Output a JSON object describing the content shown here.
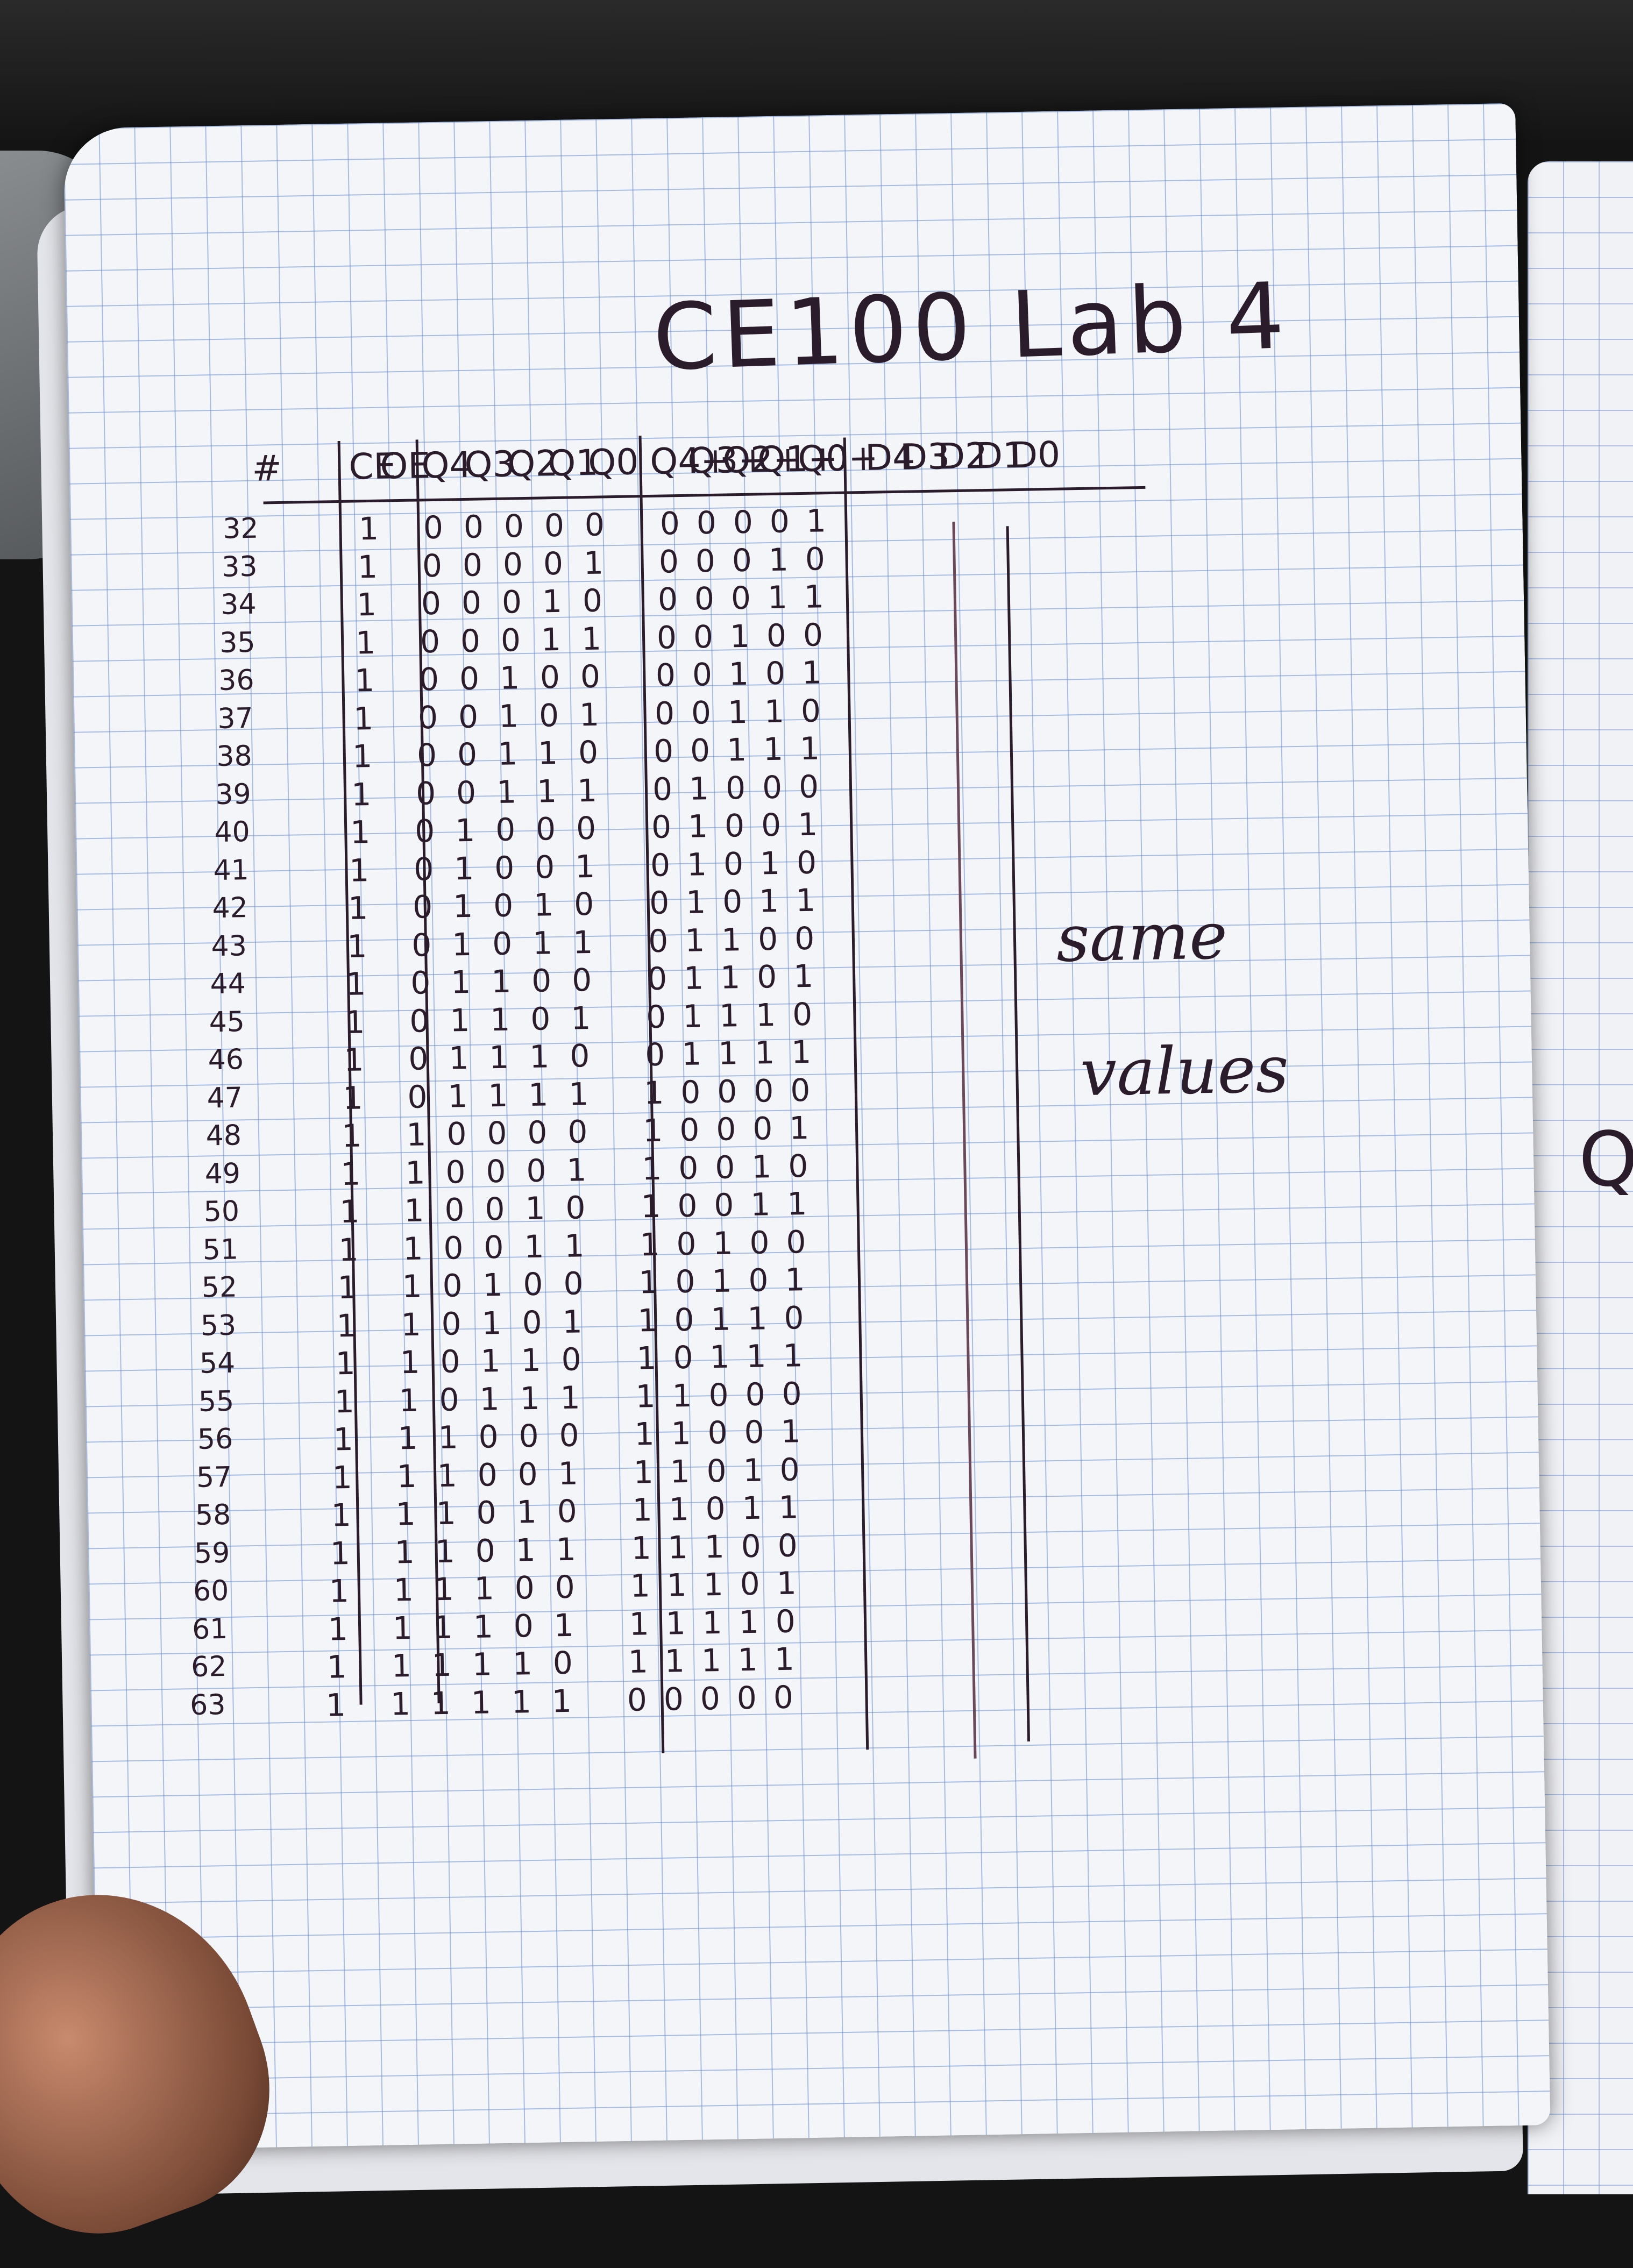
{
  "title": "CE100 Lab 4",
  "headers": {
    "num": "#",
    "inputs": [
      "CE",
      "OE",
      "Q4",
      "Q3",
      "Q2",
      "Q1",
      "Q0"
    ],
    "next": [
      "Q4+",
      "Q3+",
      "Q2+",
      "Q1+",
      "Q0+"
    ],
    "outputs": [
      "D4",
      "D3",
      "D2",
      "D1",
      "D0"
    ]
  },
  "rows": [
    {
      "n": "32",
      "ce": "1",
      "q": "00000",
      "qn": "00001"
    },
    {
      "n": "33",
      "ce": "1",
      "q": "00001",
      "qn": "00010"
    },
    {
      "n": "34",
      "ce": "1",
      "q": "00010",
      "qn": "00011"
    },
    {
      "n": "35",
      "ce": "1",
      "q": "00011",
      "qn": "00100"
    },
    {
      "n": "36",
      "ce": "1",
      "q": "00100",
      "qn": "00101"
    },
    {
      "n": "37",
      "ce": "1",
      "q": "00101",
      "qn": "00110"
    },
    {
      "n": "38",
      "ce": "1",
      "q": "00110",
      "qn": "00111"
    },
    {
      "n": "39",
      "ce": "1",
      "q": "00111",
      "qn": "01000"
    },
    {
      "n": "40",
      "ce": "1",
      "q": "01000",
      "qn": "01001"
    },
    {
      "n": "41",
      "ce": "1",
      "q": "01001",
      "qn": "01010"
    },
    {
      "n": "42",
      "ce": "1",
      "q": "01010",
      "qn": "01011"
    },
    {
      "n": "43",
      "ce": "1",
      "q": "01011",
      "qn": "01100"
    },
    {
      "n": "44",
      "ce": "1",
      "q": "01100",
      "qn": "01101"
    },
    {
      "n": "45",
      "ce": "1",
      "q": "01101",
      "qn": "01110"
    },
    {
      "n": "46",
      "ce": "1",
      "q": "01110",
      "qn": "01111"
    },
    {
      "n": "47",
      "ce": "1",
      "q": "01111",
      "qn": "10000"
    },
    {
      "n": "48",
      "ce": "1",
      "q": "10000",
      "qn": "10001"
    },
    {
      "n": "49",
      "ce": "1",
      "q": "10001",
      "qn": "10010"
    },
    {
      "n": "50",
      "ce": "1",
      "q": "10010",
      "qn": "10011"
    },
    {
      "n": "51",
      "ce": "1",
      "q": "10011",
      "qn": "10100"
    },
    {
      "n": "52",
      "ce": "1",
      "q": "10100",
      "qn": "10101"
    },
    {
      "n": "53",
      "ce": "1",
      "q": "10101",
      "qn": "10110"
    },
    {
      "n": "54",
      "ce": "1",
      "q": "10110",
      "qn": "10111"
    },
    {
      "n": "55",
      "ce": "1",
      "q": "10111",
      "qn": "11000"
    },
    {
      "n": "56",
      "ce": "1",
      "q": "11000",
      "qn": "11001"
    },
    {
      "n": "57",
      "ce": "1",
      "q": "11001",
      "qn": "11010"
    },
    {
      "n": "58",
      "ce": "1",
      "q": "11010",
      "qn": "11011"
    },
    {
      "n": "59",
      "ce": "1",
      "q": "11011",
      "qn": "11100"
    },
    {
      "n": "60",
      "ce": "1",
      "q": "11100",
      "qn": "11101"
    },
    {
      "n": "61",
      "ce": "1",
      "q": "11101",
      "qn": "11110"
    },
    {
      "n": "62",
      "ce": "1",
      "q": "11110",
      "qn": "11111"
    },
    {
      "n": "63",
      "ce": "1",
      "q": "11111",
      "qn": "00000"
    }
  ],
  "note_line1": "same",
  "note_line2": "values",
  "right_page_letter": "Q"
}
